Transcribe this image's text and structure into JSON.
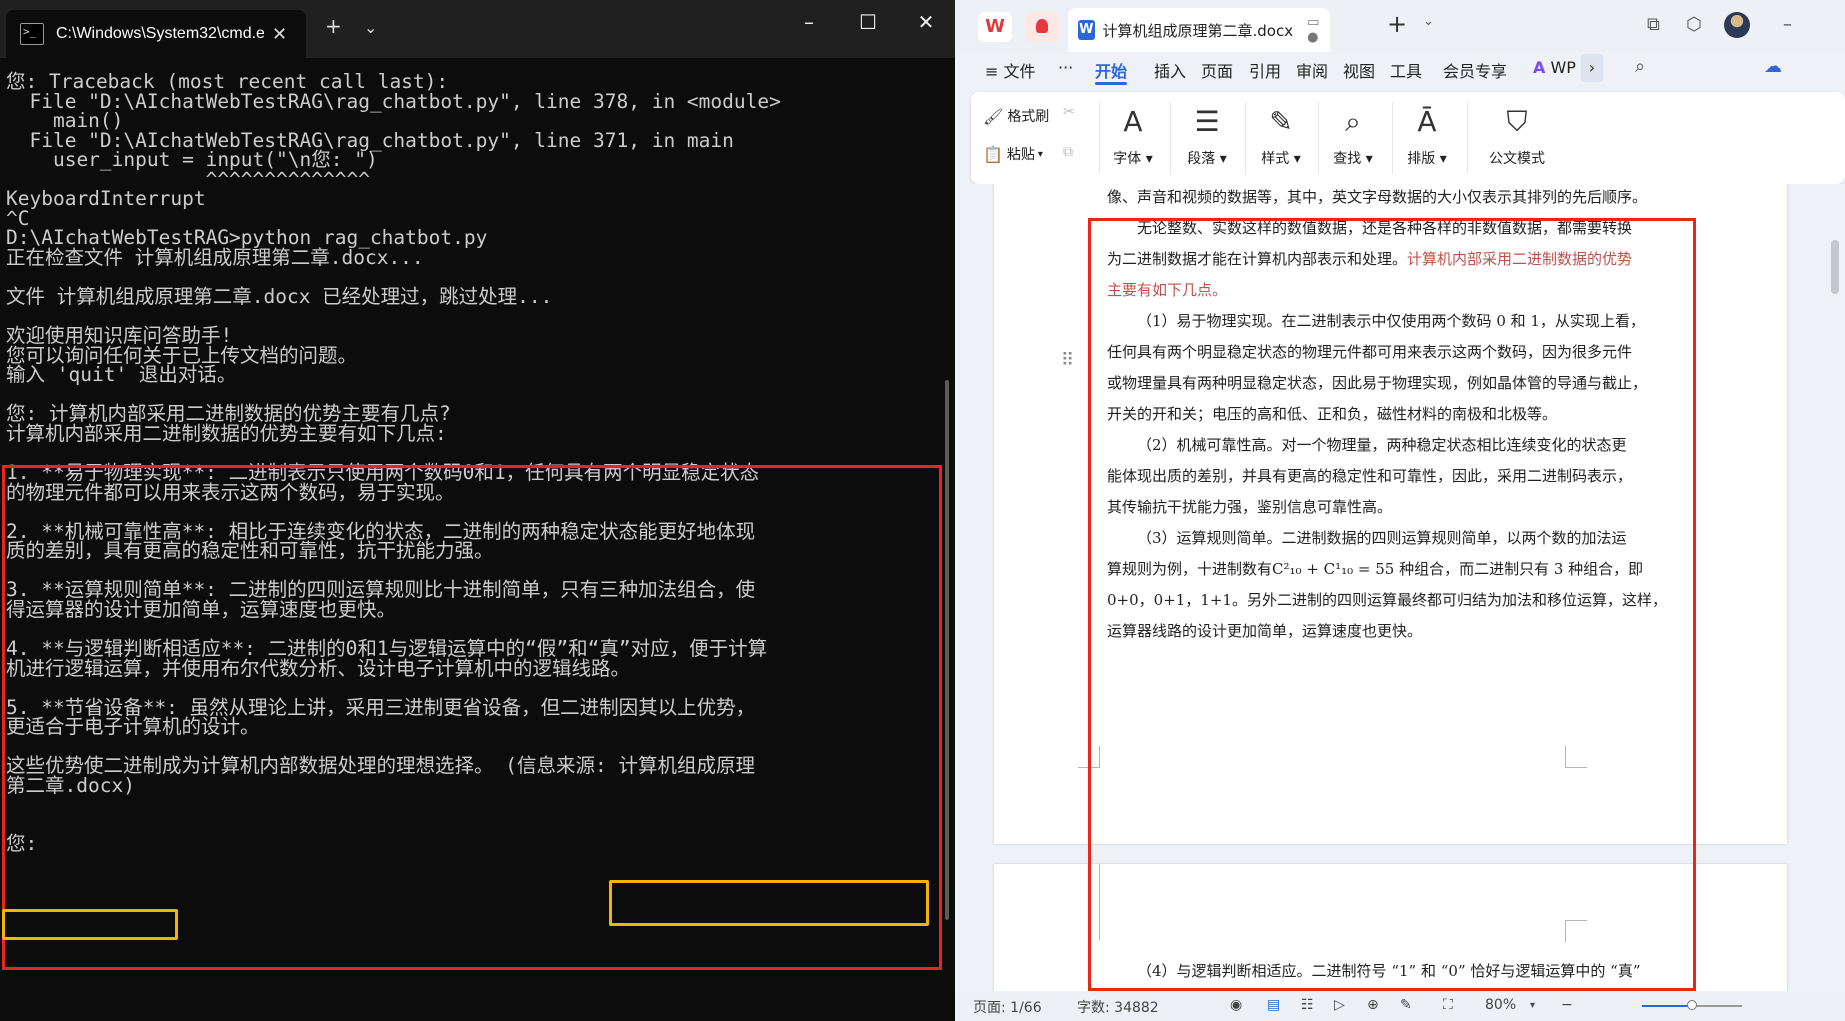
{
  "terminal": {
    "tab_title": "C:\\Windows\\System32\\cmd.e",
    "lines": [
      "您: Traceback (most recent call last):",
      "  File \"D:\\AIchatWebTestRAG\\rag_chatbot.py\", line 378, in <module>",
      "    main()",
      "  File \"D:\\AIchatWebTestRAG\\rag_chatbot.py\", line 371, in main",
      "    user_input = input(\"\\n您: \")",
      "                 ^^^^^^^^^^^^^^",
      "KeyboardInterrupt",
      "^C",
      "D:\\AIchatWebTestRAG>python rag_chatbot.py",
      "正在检查文件 计算机组成原理第二章.docx...",
      "",
      "文件 计算机组成原理第二章.docx 已经处理过，跳过处理...",
      "",
      "欢迎使用知识库问答助手!",
      "您可以询问任何关于已上传文档的问题。",
      "输入 'quit' 退出对话。",
      "",
      "您: 计算机内部采用二进制数据的优势主要有几点?",
      "计算机内部采用二进制数据的优势主要有如下几点:",
      "",
      "1. **易于物理实现**: 二进制表示只使用两个数码0和1，任何具有两个明显稳定状态",
      "的物理元件都可以用来表示这两个数码，易于实现。",
      "",
      "2. **机械可靠性高**: 相比于连续变化的状态，二进制的两种稳定状态能更好地体现",
      "质的差别，具有更高的稳定性和可靠性，抗干扰能力强。",
      "",
      "3. **运算规则简单**: 二进制的四则运算规则比十进制简单，只有三种加法组合，使",
      "得运算器的设计更加简单，运算速度也更快。",
      "",
      "4. **与逻辑判断相适应**: 二进制的0和1与逻辑运算中的“假”和“真”对应，便于计算",
      "机进行逻辑运算，并使用布尔代数分析、设计电子计算机中的逻辑线路。",
      "",
      "5. **节省设备**: 虽然从理论上讲，采用三进制更省设备，但二进制因其以上优势，",
      "更适合于电子计算机的设计。",
      "",
      "这些优势使二进制成为计算机内部数据处理的理想选择。 (信息来源: 计算机组成原理",
      "第二章.docx)",
      "",
      "",
      "您:"
    ]
  },
  "wps": {
    "doc_tab_title": "计算机组成原理第二章.docx",
    "menu": [
      "文件",
      "···",
      "开始",
      "插入",
      "页面",
      "引用",
      "审阅",
      "视图",
      "工具",
      "会员专享"
    ],
    "wps_ai": "WP",
    "ribbon": {
      "format_painter": "格式刷",
      "paste": "粘贴",
      "font": "字体",
      "paragraph": "段落",
      "style": "样式",
      "find": "查找",
      "layout": "排版",
      "official_mode": "公文模式"
    },
    "doc_lines": {
      "l0": "像、声音和视频的数据等，其中，英文字母数据的大小仅表示其排列的先后顺序。",
      "p1a": "无论整数、实数这样的数值数据，还是各种各样的非数值数据，都需要转换",
      "p1b": "为二进制数据才能在计算机内部表示和处理。",
      "p1c_red": "计算机内部采用二进制数据的优势",
      "p1d_red": "主要有如下几点。",
      "p2a": "（1）易于物理实现。在二进制表示中仅使用两个数码 0 和 1，从实现上看，",
      "p2b": "任何具有两个明显稳定状态的物理元件都可用来表示这两个数码，因为很多元件",
      "p2c": "或物理量具有两种明显稳定状态，因此易于物理实现，例如晶体管的导通与截止，",
      "p2d": "开关的开和关；电压的高和低、正和负，磁性材料的南极和北极等。",
      "p3a": "（2）机械可靠性高。对一个物理量，两种稳定状态相比连续变化的状态更",
      "p3b": "能体现出质的差别，并具有更高的稳定性和可靠性，因此，采用二进制码表示，",
      "p3c": "其传输抗干扰能力强，鉴别信息可靠性高。",
      "p4a": "（3）运算规则简单。二进制数据的四则运算规则简单，以两个数的加法运",
      "p4b": "算规则为例，十进制数有C²₁₀ + C¹₁₀ = 55 种组合，而二进制只有 3 种组合，即",
      "p4c": "0+0，0+1，1+1。另外二进制的四则运算最终都可归结为加法和移位运算，这样，",
      "p4d": "运算器线路的设计更加简单，运算速度也更快。",
      "p5": "（4）与逻辑判断相适应。二进制符号 “1” 和 “0” 恰好与逻辑运算中的 “真”"
    },
    "status": {
      "page": "页面: 1/66",
      "words": "字数: 34882",
      "zoom": "80%",
      "zoom_fraction": 0.5
    }
  },
  "colors": {
    "highlight_red": "#e8261c",
    "highlight_yellow": "#f4b400",
    "accent_blue": "#2f66d6"
  }
}
